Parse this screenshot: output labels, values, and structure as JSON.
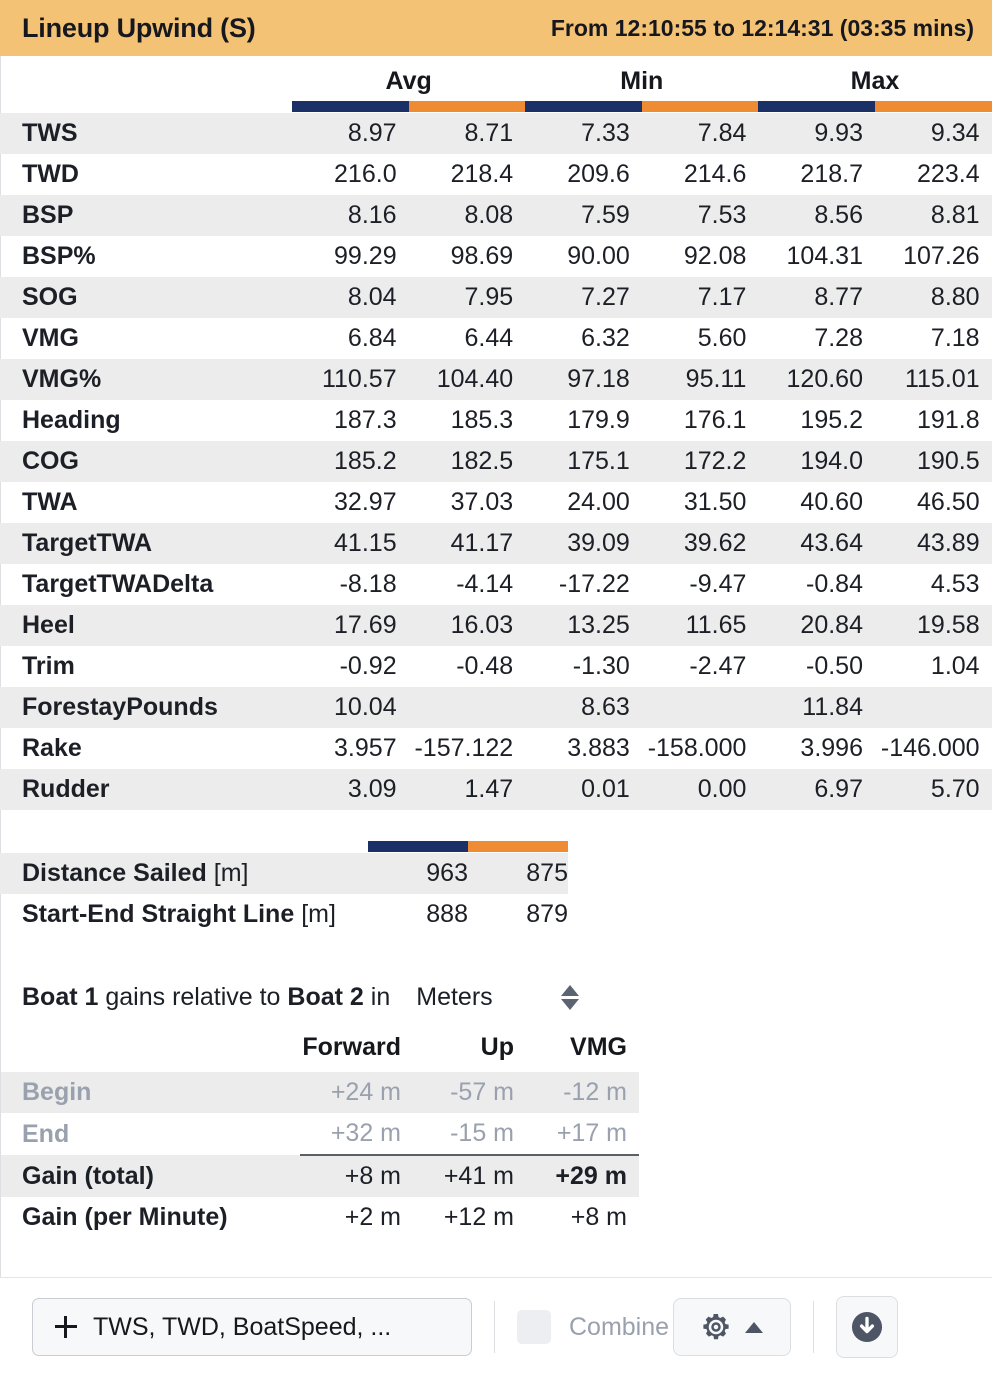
{
  "header": {
    "title": "Lineup Upwind (S)",
    "range": "From 12:10:55 to 12:14:31 (03:35 mins)"
  },
  "colors": {
    "titlebar": "#f4c275",
    "boat1": "#1b3066",
    "boat2": "#ef8c33",
    "stripe": "#ececec",
    "muted": "#9aa1ae"
  },
  "stats_table": {
    "groups": [
      "Avg",
      "Min",
      "Max"
    ],
    "row_label_header": "",
    "rows": [
      {
        "label": "TWS",
        "values": [
          "8.97",
          "8.71",
          "7.33",
          "7.84",
          "9.93",
          "9.34"
        ]
      },
      {
        "label": "TWD",
        "values": [
          "216.0",
          "218.4",
          "209.6",
          "214.6",
          "218.7",
          "223.4"
        ]
      },
      {
        "label": "BSP",
        "values": [
          "8.16",
          "8.08",
          "7.59",
          "7.53",
          "8.56",
          "8.81"
        ]
      },
      {
        "label": "BSP%",
        "values": [
          "99.29",
          "98.69",
          "90.00",
          "92.08",
          "104.31",
          "107.26"
        ]
      },
      {
        "label": "SOG",
        "values": [
          "8.04",
          "7.95",
          "7.27",
          "7.17",
          "8.77",
          "8.80"
        ]
      },
      {
        "label": "VMG",
        "values": [
          "6.84",
          "6.44",
          "6.32",
          "5.60",
          "7.28",
          "7.18"
        ]
      },
      {
        "label": "VMG%",
        "values": [
          "110.57",
          "104.40",
          "97.18",
          "95.11",
          "120.60",
          "115.01"
        ]
      },
      {
        "label": "Heading",
        "values": [
          "187.3",
          "185.3",
          "179.9",
          "176.1",
          "195.2",
          "191.8"
        ]
      },
      {
        "label": "COG",
        "values": [
          "185.2",
          "182.5",
          "175.1",
          "172.2",
          "194.0",
          "190.5"
        ]
      },
      {
        "label": "TWA",
        "values": [
          "32.97",
          "37.03",
          "24.00",
          "31.50",
          "40.60",
          "46.50"
        ]
      },
      {
        "label": "TargetTWA",
        "values": [
          "41.15",
          "41.17",
          "39.09",
          "39.62",
          "43.64",
          "43.89"
        ]
      },
      {
        "label": "TargetTWADelta",
        "values": [
          "-8.18",
          "-4.14",
          "-17.22",
          "-9.47",
          "-0.84",
          "4.53"
        ]
      },
      {
        "label": "Heel",
        "values": [
          "17.69",
          "16.03",
          "13.25",
          "11.65",
          "20.84",
          "19.58"
        ]
      },
      {
        "label": "Trim",
        "values": [
          "-0.92",
          "-0.48",
          "-1.30",
          "-2.47",
          "-0.50",
          "1.04"
        ]
      },
      {
        "label": "ForestayPounds",
        "values": [
          "10.04",
          "",
          "8.63",
          "",
          "11.84",
          ""
        ]
      },
      {
        "label": "Rake",
        "values": [
          "3.957",
          "-157.122",
          "3.883",
          "-158.000",
          "3.996",
          "-146.000"
        ]
      },
      {
        "label": "Rudder",
        "values": [
          "3.09",
          "1.47",
          "0.01",
          "0.00",
          "6.97",
          "5.70"
        ]
      }
    ]
  },
  "distance_table": {
    "rows": [
      {
        "label": "Distance Sailed",
        "unit": "[m]",
        "values": [
          "963",
          "875"
        ]
      },
      {
        "label": "Start-End Straight Line",
        "unit": "[m]",
        "values": [
          "888",
          "879"
        ]
      }
    ]
  },
  "gains": {
    "sentence": {
      "boat_a": "Boat 1",
      "mid": "gains relative to",
      "boat_b": "Boat 2",
      "in": "in",
      "unit": "Meters"
    },
    "columns": [
      "Forward",
      "Up",
      "VMG"
    ],
    "rows": [
      {
        "label": "Begin",
        "values": [
          "+24 m",
          "-57 m",
          "-12 m"
        ]
      },
      {
        "label": "End",
        "values": [
          "+32 m",
          "-15 m",
          "+17 m"
        ]
      },
      {
        "label": "Gain (total)",
        "values": [
          "+8 m",
          "+41 m",
          "+29 m"
        ]
      },
      {
        "label": "Gain (per Minute)",
        "values": [
          "+2 m",
          "+12 m",
          "+8 m"
        ]
      }
    ]
  },
  "toolbar": {
    "add_channels_label": "TWS, TWD, BoatSpeed, ...",
    "combine_label": "Combine"
  }
}
